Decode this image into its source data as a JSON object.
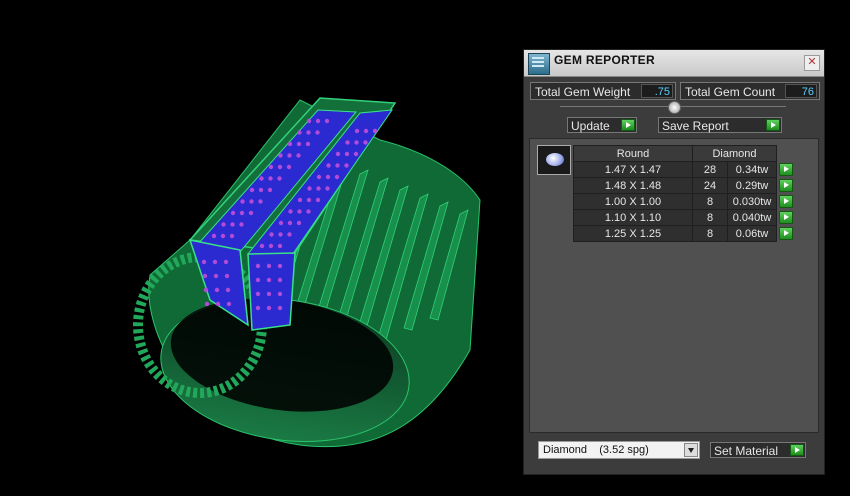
{
  "panel": {
    "title": "GEM REPORTER",
    "close_glyph": "✕",
    "total_weight_label": "Total Gem Weight",
    "total_weight_value": ".75",
    "total_count_label": "Total Gem Count",
    "total_count_value": "76",
    "update_label": "Update",
    "save_report_label": "Save Report",
    "set_material_label": "Set Material",
    "material_select_value": "Diamond    (3.52 spg)"
  },
  "table": {
    "headers": [
      "Round",
      "Diamond"
    ],
    "rows": [
      {
        "size": "1.47 X 1.47",
        "count": "28",
        "weight": "0.34tw"
      },
      {
        "size": "1.48 X 1.48",
        "count": "24",
        "weight": "0.29tw"
      },
      {
        "size": "1.00 X 1.00",
        "count": "8",
        "weight": "0.030tw"
      },
      {
        "size": "1.10 X 1.10",
        "count": "8",
        "weight": "0.040tw"
      },
      {
        "size": "1.25 X 1.25",
        "count": "8",
        "weight": "0.06tw"
      }
    ]
  },
  "colors": {
    "ring_green": "#1f8a4c",
    "gem_blue": "#3b36d8",
    "value_text": "#5ad2ff",
    "go_button": "#2fae2f"
  },
  "icons": [
    "gem-reporter-icon",
    "close-icon",
    "round-gem-icon",
    "play-arrow-icon",
    "dropdown-arrow-icon"
  ]
}
